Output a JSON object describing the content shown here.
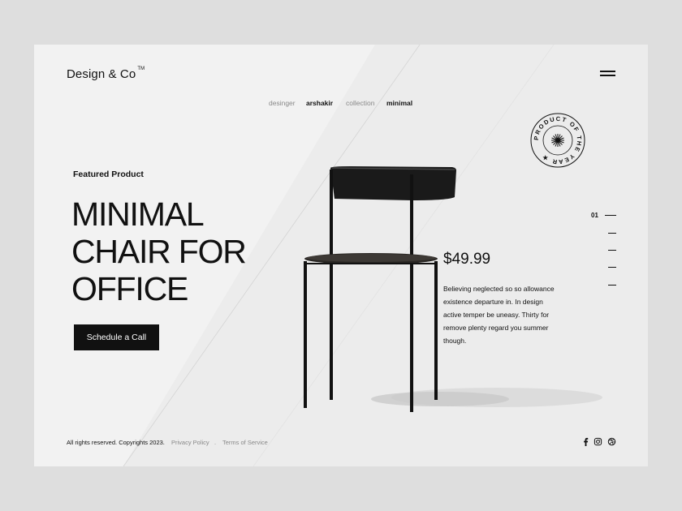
{
  "brand": {
    "name": "Design & Co",
    "trademark": "TM"
  },
  "menu": {
    "icon": "hamburger-menu-icon"
  },
  "meta": {
    "designer_label": "desinger",
    "designer_value": "arshakir",
    "collection_label": "collection",
    "collection_value": "minimal"
  },
  "hero": {
    "eyebrow": "Featured Product",
    "title_line1": "MINIMAL",
    "title_line2": "CHAIR FOR",
    "title_line3": "OFFICE",
    "cta_label": "Schedule a Call"
  },
  "badge": {
    "text": "PRODUCT OF THE YEAR ★ ",
    "icon": "starburst-icon"
  },
  "product": {
    "price": "$49.99",
    "description": "Believing neglected so so allowance existence departure in. In design active temper be uneasy. Thirty for remove plenty regard you summer though."
  },
  "pager": {
    "current": "01",
    "total_slides": 5
  },
  "footer": {
    "copyright": "All rights reserved. Copyrights 2023.",
    "privacy": "Privacy Policy",
    "separator": ".",
    "terms": "Terms of Service",
    "social_icons": [
      "facebook-icon",
      "instagram-icon",
      "dribbble-icon"
    ]
  },
  "colors": {
    "background": "#dedede",
    "card": "#f2f2f2",
    "accent": "#111111",
    "muted": "#888888"
  }
}
